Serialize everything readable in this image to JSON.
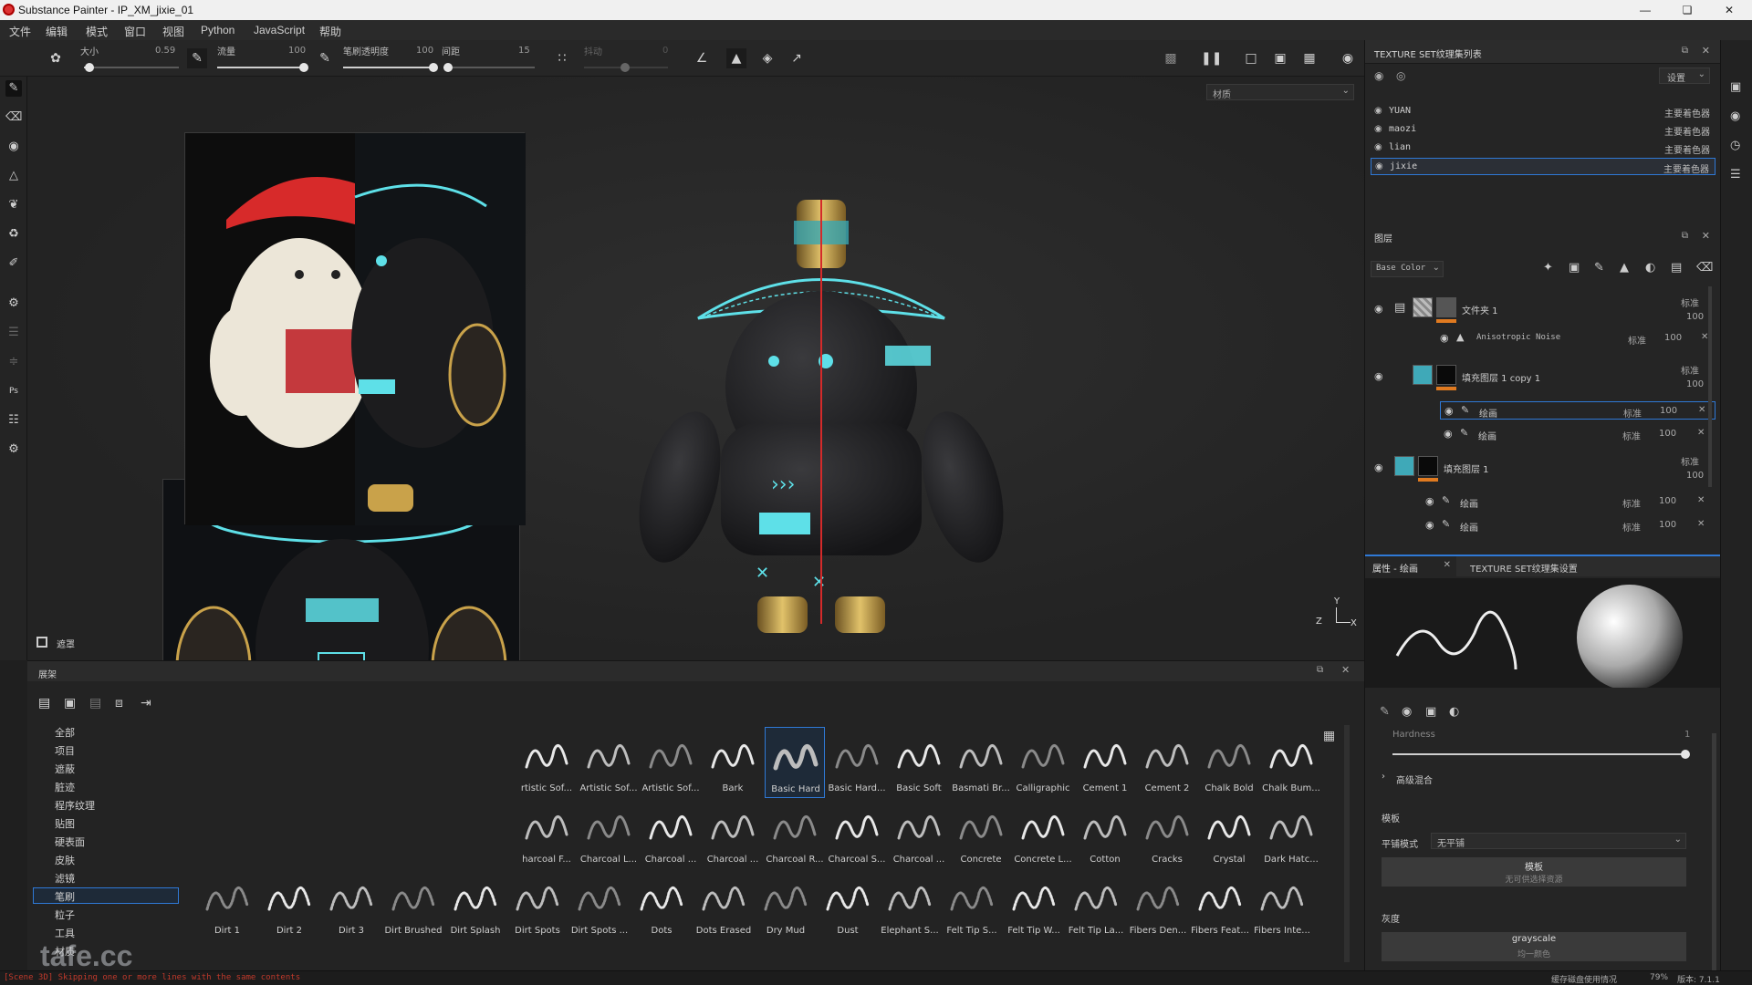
{
  "window": {
    "title": "Substance Painter - IP_XM_jixie_01"
  },
  "menu": [
    "文件",
    "编辑",
    "模式",
    "窗口",
    "视图",
    "Python",
    "JavaScript",
    "帮助"
  ],
  "tool_options": {
    "size_label": "大小",
    "size_value": "0.59",
    "flow_label": "流量",
    "flow_value": "100",
    "stroke_opacity_label": "笔刷透明度",
    "stroke_opacity_value": "100",
    "spacing_label": "间距",
    "spacing_value": "15",
    "jitter_label": "抖动",
    "jitter_value": "0"
  },
  "viewport": {
    "material_dropdown": "材质",
    "axis_labels": {
      "y": "Y",
      "z": "Z",
      "x": "X"
    },
    "mask_label": "遮罩"
  },
  "texture_set_panel": {
    "title": "TEXTURE SET纹理集列表",
    "settings_button": "设置",
    "items": [
      {
        "name": "YUAN",
        "shader": "主要着色器",
        "selected": false
      },
      {
        "name": "maozi",
        "shader": "主要着色器",
        "selected": false
      },
      {
        "name": "lian",
        "shader": "主要着色器",
        "selected": false
      },
      {
        "name": "jixie",
        "shader": "主要着色器",
        "selected": true
      }
    ]
  },
  "layers_panel": {
    "title": "图层",
    "channel": "Base Color",
    "layers": [
      {
        "name": "文件夹 1",
        "blend": "标准",
        "opacity": "100",
        "kind": "folder"
      },
      {
        "name": "Anisotropic Noise",
        "blend": "标准",
        "opacity": "100",
        "kind": "effect"
      },
      {
        "name": "填充图层 1 copy 1",
        "blend": "标准",
        "opacity": "100",
        "kind": "fill"
      },
      {
        "name": "绘画",
        "blend": "标准",
        "opacity": "100",
        "kind": "paint",
        "selected": true
      },
      {
        "name": "绘画",
        "blend": "标准",
        "opacity": "100",
        "kind": "paint"
      },
      {
        "name": "填充图层 1",
        "blend": "标准",
        "opacity": "100",
        "kind": "fill"
      },
      {
        "name": "绘画",
        "blend": "标准",
        "opacity": "100",
        "kind": "paint"
      },
      {
        "name": "绘画",
        "blend": "标准",
        "opacity": "100",
        "kind": "paint"
      }
    ]
  },
  "properties_panel": {
    "tab_active": "属性 - 绘画",
    "tab_other": "TEXTURE SET纹理集设置",
    "hardness_label": "Hardness",
    "hardness_value": "1",
    "advanced_blend": "高级混合",
    "stencil_section": "模板",
    "tiling_label": "平铺模式",
    "tiling_value": "无平铺",
    "stencil_button": "模板",
    "stencil_sub": "无可供选择资源",
    "gray_section": "灰度",
    "gray_button": "grayscale",
    "gray_sub": "均一颜色"
  },
  "shelf": {
    "title": "展架",
    "categories": [
      "全部",
      "项目",
      "遮蔽",
      "脏迹",
      "程序纹理",
      "贴图",
      "硬表面",
      "皮肤",
      "滤镜",
      "笔刷",
      "粒子",
      "工具",
      "材质"
    ],
    "selected_category": "笔刷",
    "brush_rows": [
      [
        "rtistic Sof...",
        "Artistic Sof...",
        "Artistic Sof...",
        "Bark",
        "Basic Hard",
        "Basic Hard...",
        "Basic Soft",
        "Basmati Br...",
        "Calligraphic",
        "Cement 1",
        "Cement 2",
        "Chalk Bold",
        "Chalk Bum..."
      ],
      [
        "harcoal F...",
        "Charcoal L...",
        "Charcoal ...",
        "Charcoal ...",
        "Charcoal R...",
        "Charcoal S...",
        "Charcoal ...",
        "Concrete",
        "Concrete L...",
        "Cotton",
        "Cracks",
        "Crystal",
        "Dark Hatc..."
      ],
      [
        "Dirt 1",
        "Dirt 2",
        "Dirt 3",
        "Dirt Brushed",
        "Dirt Splash",
        "Dirt Spots",
        "Dirt Spots ...",
        "Dots",
        "Dots Erased",
        "Dry Mud",
        "Dust",
        "Elephant S...",
        "Felt Tip S...",
        "Felt Tip W...",
        "Felt Tip La...",
        "Fibers Den...",
        "Fibers Feat...",
        "Fibers Inte..."
      ]
    ],
    "selected_brush": "Basic Hard"
  },
  "status": {
    "log": "[Scene 3D] Skipping one or more lines with the same contents",
    "disk": "缓存磁盘使用情况",
    "percent": "79%",
    "version": "版本: 7.1.1"
  },
  "watermark": "tafe.cc",
  "colors": {
    "accent": "#2f79d6",
    "cyan": "#5ee0e8",
    "gold": "#c9a24a"
  }
}
